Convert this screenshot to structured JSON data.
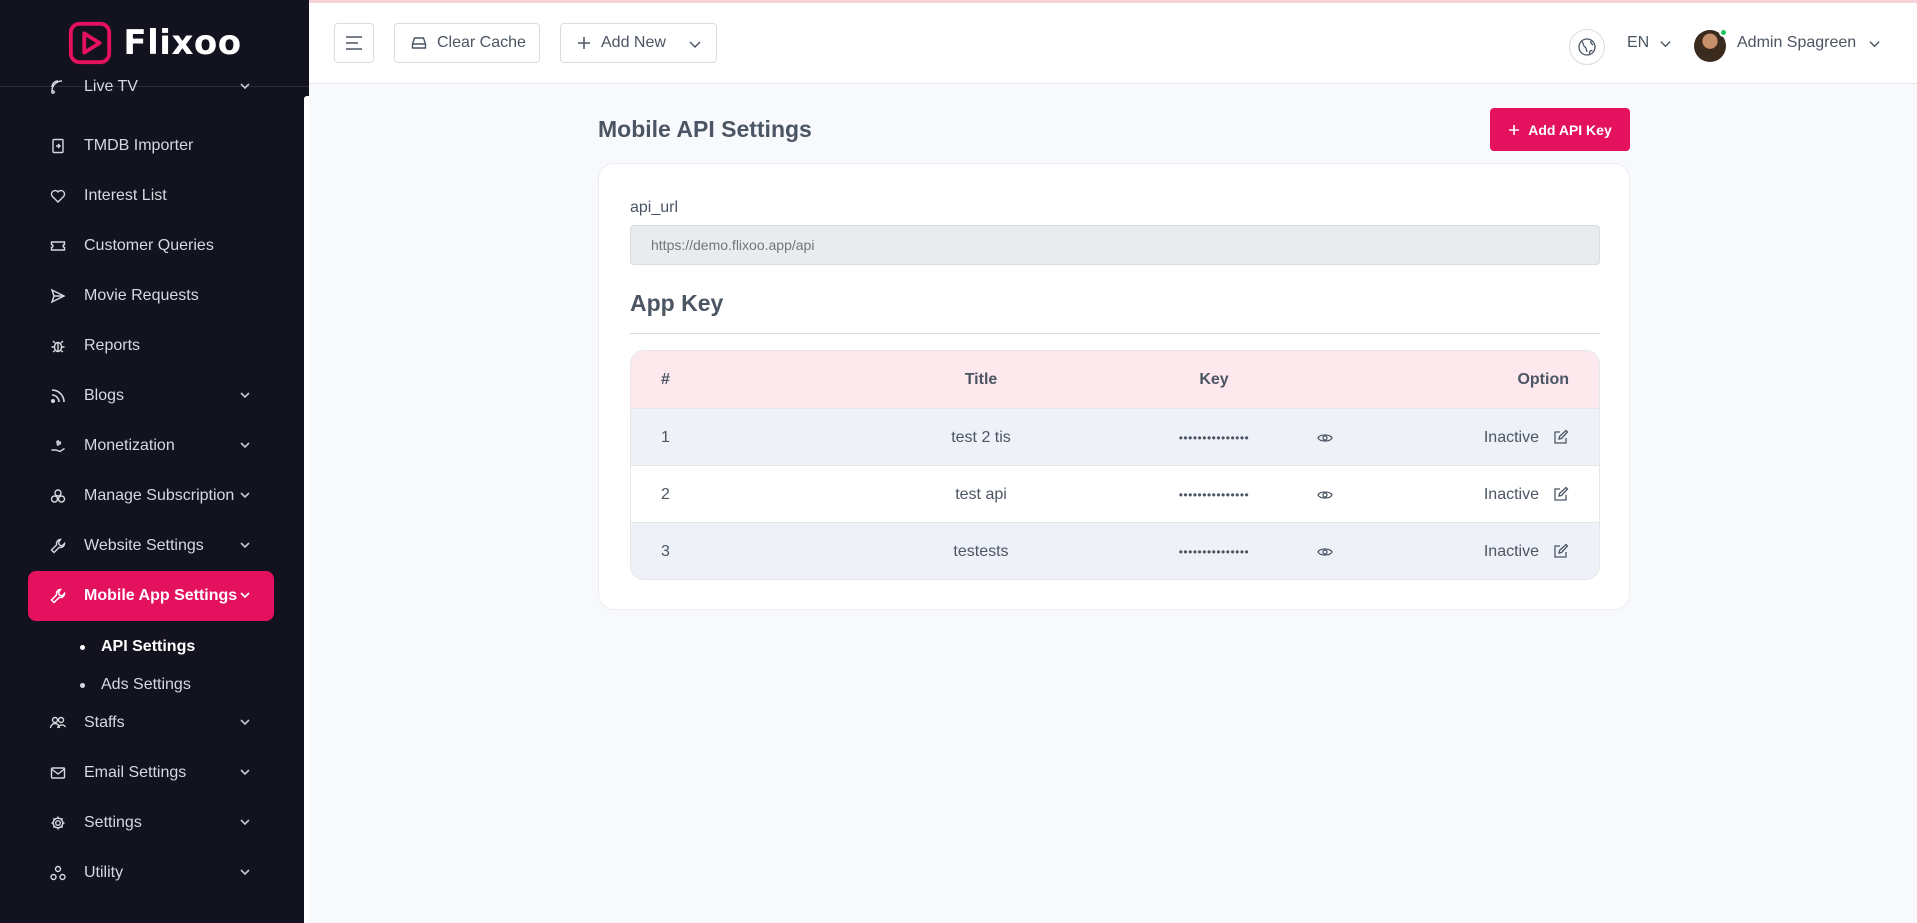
{
  "brand": {
    "name": "Flixoo"
  },
  "header": {
    "clear_cache": "Clear Cache",
    "add_new": "Add New",
    "language": "EN",
    "user_name": "Admin Spagreen"
  },
  "sidebar": {
    "items": [
      {
        "label": "Live TV",
        "icon": "tv-icon"
      },
      {
        "label": "TMDB Importer",
        "icon": "import-icon"
      },
      {
        "label": "Interest List",
        "icon": "heart-icon"
      },
      {
        "label": "Customer Queries",
        "icon": "ticket-icon"
      },
      {
        "label": "Movie Requests",
        "icon": "send-icon"
      },
      {
        "label": "Reports",
        "icon": "bug-icon"
      },
      {
        "label": "Blogs",
        "icon": "rss-icon"
      },
      {
        "label": "Monetization",
        "icon": "money-icon"
      },
      {
        "label": "Manage Subscription",
        "icon": "subscription-icon"
      },
      {
        "label": "Website Settings",
        "icon": "wrench-icon"
      },
      {
        "label": "Mobile App Settings",
        "icon": "wrench-icon"
      },
      {
        "label": "Staffs",
        "icon": "users-icon"
      },
      {
        "label": "Email Settings",
        "icon": "mail-icon"
      },
      {
        "label": "Settings",
        "icon": "gear-icon"
      },
      {
        "label": "Utility",
        "icon": "utility-icon"
      }
    ],
    "sub_items": [
      {
        "label": "API Settings"
      },
      {
        "label": "Ads Settings"
      }
    ]
  },
  "main": {
    "title": "Mobile API Settings",
    "add_api_key": "Add API Key",
    "api_url_label": "api_url",
    "api_url_placeholder": "https://demo.flixoo.app/api",
    "section_title": "App Key",
    "table": {
      "headers": [
        "#",
        "Title",
        "Key",
        "Option"
      ],
      "rows": [
        {
          "num": "1",
          "title": "test 2 tis",
          "key": "•••••••••••••••",
          "status": "Inactive"
        },
        {
          "num": "2",
          "title": "test api",
          "key": "•••••••••••••••",
          "status": "Inactive"
        },
        {
          "num": "3",
          "title": "testests",
          "key": "•••••••••••••••",
          "status": "Inactive"
        }
      ]
    }
  },
  "colors": {
    "accent": "#e4115f",
    "sidebar_bg": "#13131f",
    "header_row_bg": "#fde8ee"
  }
}
